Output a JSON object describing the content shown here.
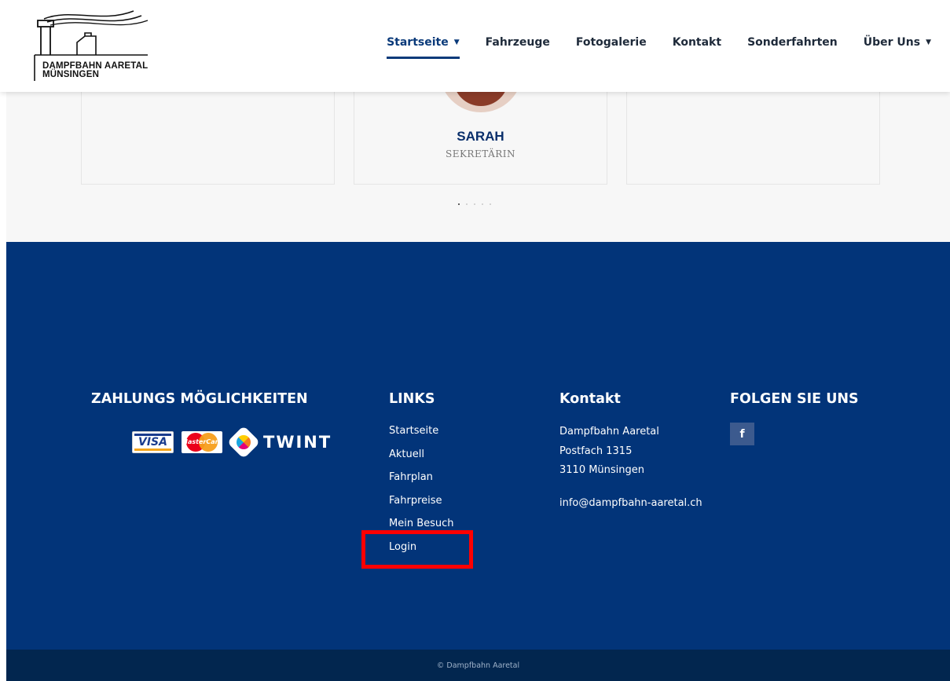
{
  "header": {
    "logo_line1": "DAMPFBAHN AARETAL",
    "logo_line2": "MÜNSINGEN",
    "nav": [
      {
        "label": "Startseite",
        "active": true,
        "dropdown": true
      },
      {
        "label": "Fahrzeuge",
        "active": false,
        "dropdown": false
      },
      {
        "label": "Fotogalerie",
        "active": false,
        "dropdown": false
      },
      {
        "label": "Kontakt",
        "active": false,
        "dropdown": false
      },
      {
        "label": "Sonderfahrten",
        "active": false,
        "dropdown": false
      },
      {
        "label": "Über Uns",
        "active": false,
        "dropdown": true
      }
    ]
  },
  "team": {
    "member": {
      "name": "SARAH",
      "role": "SEKRETÄRIN"
    },
    "carousel_dots": 5,
    "active_dot": 0
  },
  "footer": {
    "payments": {
      "title": "ZAHLUNGS MÖGLICHKEITEN",
      "visa": "VISA",
      "mastercard": "MasterCard",
      "twint": "TWINT"
    },
    "links": {
      "title": "LINKS",
      "items": [
        "Startseite",
        "Aktuell",
        "Fahrplan",
        "Fahrpreise",
        "Mein Besuch",
        "Login"
      ]
    },
    "contact": {
      "title": "Kontakt",
      "name": "Dampfbahn Aaretal",
      "po_box": "Postfach 1315",
      "city": "3110 Münsingen",
      "email": "info@dampfbahn-aaretal.ch"
    },
    "social": {
      "title": "FOLGEN SIE UNS",
      "facebook_glyph": "f"
    }
  },
  "copyright": "© Dampfbahn Aaretal",
  "colors": {
    "footer_bg": "#023479",
    "copyright_bg": "#02264f",
    "accent": "#0a3a7a",
    "highlight": "#ff0000"
  }
}
